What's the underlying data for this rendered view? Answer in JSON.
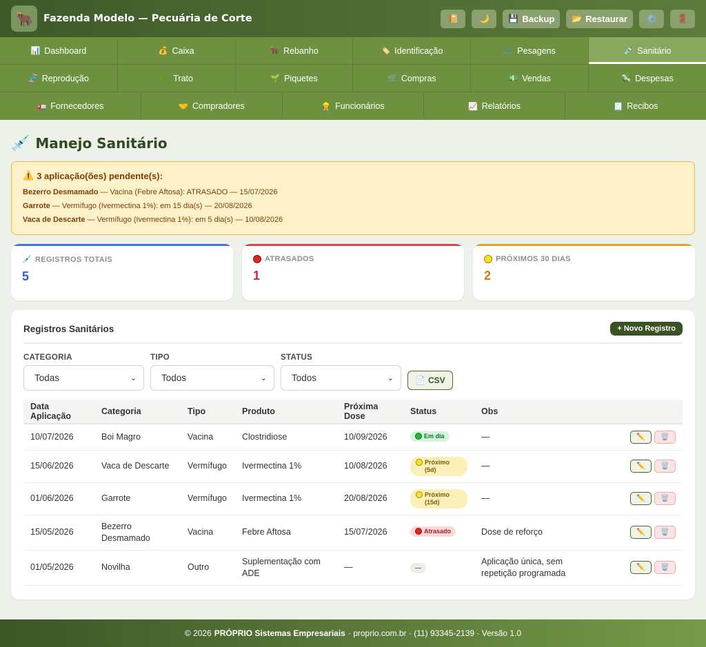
{
  "header": {
    "logo_icon": "cow-icon",
    "title": "Fazenda Modelo — Pecuária de Corte",
    "actions": {
      "notes_icon": "notebook-icon",
      "theme_icon": "moon-icon",
      "backup_label": "Backup",
      "backup_icon": "floppy-icon",
      "restore_label": "Restaurar",
      "restore_icon": "folder-icon",
      "settings_icon": "gear-icon",
      "logout_icon": "door-icon"
    }
  },
  "nav": {
    "row1": [
      {
        "label": "Dashboard",
        "icon": "📊"
      },
      {
        "label": "Caixa",
        "icon": "💰"
      },
      {
        "label": "Rebanho",
        "icon": "🐂"
      },
      {
        "label": "Identificação",
        "icon": "🏷️"
      },
      {
        "label": "Pesagens",
        "icon": "⚖️"
      },
      {
        "label": "Sanitário",
        "icon": "💉",
        "active": true
      }
    ],
    "row2": [
      {
        "label": "Reprodução",
        "icon": "🧬"
      },
      {
        "label": "Trato",
        "icon": "🌿"
      },
      {
        "label": "Piquetes",
        "icon": "🌱"
      },
      {
        "label": "Compras",
        "icon": "🛒"
      },
      {
        "label": "Vendas",
        "icon": "💵"
      },
      {
        "label": "Despesas",
        "icon": "💸"
      }
    ],
    "row3": [
      {
        "label": "Fornecedores",
        "icon": "🚛"
      },
      {
        "label": "Compradores",
        "icon": "🤝"
      },
      {
        "label": "Funcionários",
        "icon": "👷"
      },
      {
        "label": "Relatórios",
        "icon": "📈"
      },
      {
        "label": "Recibos",
        "icon": "🧾"
      }
    ]
  },
  "page": {
    "title": "Manejo Sanitário",
    "title_icon": "💉"
  },
  "alert": {
    "title": "3 aplicação(ões) pendente(s):",
    "lines": [
      {
        "animal": "Bezerro Desmamado",
        "text": " — Vacina (Febre Aftosa): ATRASADO — 15/07/2026"
      },
      {
        "animal": "Garrote",
        "text": " — Vermífugo (Ivermectina 1%): em 15 dia(s) — 20/08/2026"
      },
      {
        "animal": "Vaca de Descarte",
        "text": " — Vermífugo (Ivermectina 1%): em 5 dia(s) — 10/08/2026"
      }
    ]
  },
  "stats": {
    "total": {
      "label": "REGISTROS TOTAIS",
      "value": "5",
      "color": "#2e5fc4"
    },
    "late": {
      "label": "ATRASADOS",
      "value": "1",
      "color": "#c92c2c"
    },
    "soon": {
      "label": "PRÓXIMOS 30 DIAS",
      "value": "2",
      "color": "#d67b12"
    }
  },
  "panel": {
    "title": "Registros Sanitários",
    "new_button": "+ Novo Registro",
    "filters": {
      "categoria_label": "CATEGORIA",
      "categoria_value": "Todas",
      "tipo_label": "TIPO",
      "tipo_value": "Todos",
      "status_label": "STATUS",
      "status_value": "Todos",
      "csv_label": "CSV"
    },
    "columns": [
      "Data Aplicação",
      "Categoria",
      "Tipo",
      "Produto",
      "Próxima Dose",
      "Status",
      "Obs"
    ],
    "rows": [
      {
        "data": "10/07/2026",
        "categoria": "Boi Magro",
        "tipo": "Vacina",
        "produto": "Clostridiose",
        "proxima": "10/09/2026",
        "status": "Em dia",
        "status_kind": "ok",
        "obs": "—"
      },
      {
        "data": "15/06/2026",
        "categoria": "Vaca de Descarte",
        "tipo": "Vermífugo",
        "produto": "Ivermectina 1%",
        "proxima": "10/08/2026",
        "status": "Próximo (5d)",
        "status_kind": "soon",
        "obs": "—"
      },
      {
        "data": "01/06/2026",
        "categoria": "Garrote",
        "tipo": "Vermífugo",
        "produto": "Ivermectina 1%",
        "proxima": "20/08/2026",
        "status": "Próximo (15d)",
        "status_kind": "soon",
        "obs": "—"
      },
      {
        "data": "15/05/2026",
        "categoria": "Bezerro Desmamado",
        "tipo": "Vacina",
        "produto": "Febre Aftosa",
        "proxima": "15/07/2026",
        "status": "Atrasado",
        "status_kind": "late",
        "obs": "Dose de reforço"
      },
      {
        "data": "01/05/2026",
        "categoria": "Novilha",
        "tipo": "Outro",
        "produto": "Suplementação com ADE",
        "proxima": "—",
        "status": "—",
        "status_kind": "none",
        "obs": "Aplicação única, sem repetição programada"
      }
    ]
  },
  "footer": {
    "copyright": "© 2026",
    "company": "PRÓPRIO Sistemas Empresariais",
    "details": "· proprio.com.br · (11) 93345-2139 · Versão 1.0"
  }
}
